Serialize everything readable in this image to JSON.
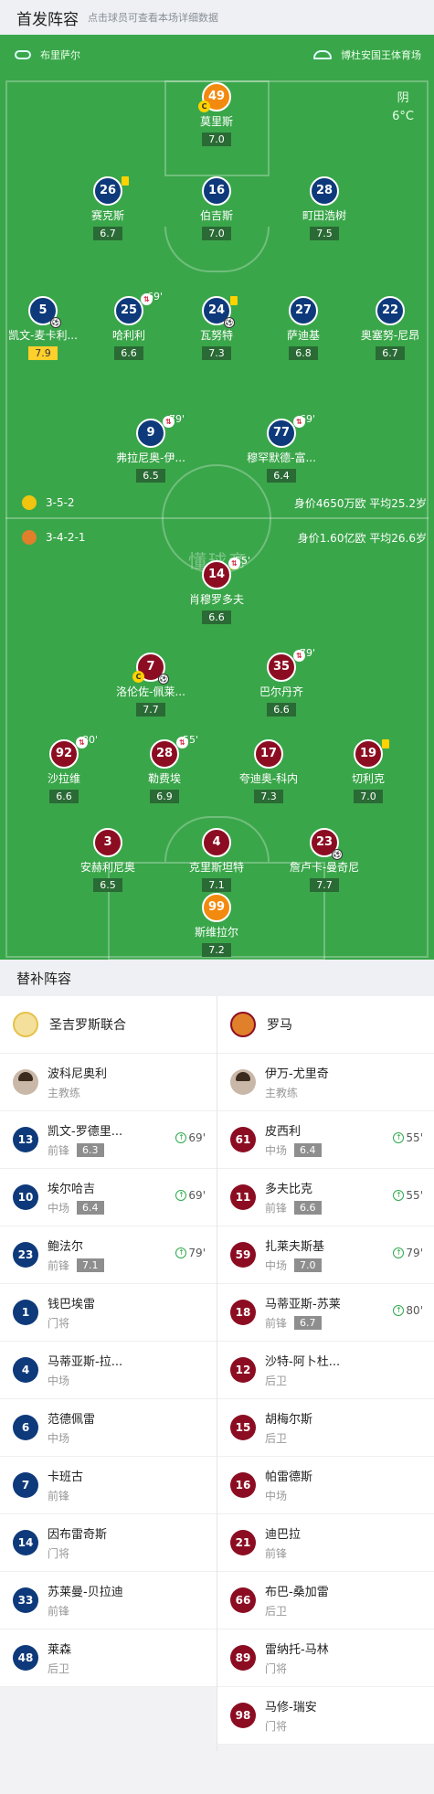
{
  "header": {
    "title": "首发阵容",
    "hint": "点击球员可查看本场详细数据"
  },
  "match": {
    "referee": "布里萨尔",
    "stadium": "博杜安国王体育场",
    "weather": "阴",
    "temp": "6°C",
    "watermark": "懂球帝"
  },
  "home": {
    "formation": "3-5-2",
    "value": "身价4650万欧 平均25.2岁",
    "logo_color": "#f1c40f"
  },
  "away": {
    "formation": "3-4-2-1",
    "value": "身价1.60亿欧 平均26.6岁",
    "logo_color": "#f39c12"
  },
  "home_players": [
    {
      "no": "49",
      "name": "莫里斯",
      "rating": "7.0",
      "kit": "o",
      "captain": true
    },
    {
      "no": "26",
      "name": "赛克斯",
      "rating": "6.7",
      "kit": "b",
      "yellow": true
    },
    {
      "no": "16",
      "name": "伯吉斯",
      "rating": "7.0",
      "kit": "b"
    },
    {
      "no": "28",
      "name": "町田浩树",
      "rating": "7.5",
      "kit": "b"
    },
    {
      "no": "5",
      "name": "凯文-麦卡利...",
      "rating": "7.9",
      "kit": "b",
      "ball": true,
      "star": true
    },
    {
      "no": "25",
      "name": "哈利利",
      "rating": "6.6",
      "kit": "b",
      "sub": "69'"
    },
    {
      "no": "24",
      "name": "瓦努特",
      "rating": "7.3",
      "kit": "b",
      "yellow": true,
      "ball": true
    },
    {
      "no": "27",
      "name": "萨迪基",
      "rating": "6.8",
      "kit": "b"
    },
    {
      "no": "22",
      "name": "奥塞努-尼昂",
      "rating": "6.7",
      "kit": "b"
    },
    {
      "no": "9",
      "name": "弗拉尼奥-伊...",
      "rating": "6.5",
      "kit": "b",
      "sub": "79'"
    },
    {
      "no": "77",
      "name": "穆罕默德-富...",
      "rating": "6.4",
      "kit": "b",
      "sub": "69'"
    }
  ],
  "away_players": [
    {
      "no": "14",
      "name": "肖穆罗多夫",
      "rating": "6.6",
      "kit": "r",
      "yellow": true,
      "sub": "55'"
    },
    {
      "no": "7",
      "name": "洛伦佐-佩莱...",
      "rating": "7.7",
      "kit": "r",
      "captain": true,
      "ball": true
    },
    {
      "no": "35",
      "name": "巴尔丹齐",
      "rating": "6.6",
      "kit": "r",
      "sub": "79'"
    },
    {
      "no": "92",
      "name": "沙拉维",
      "rating": "6.6",
      "kit": "r",
      "sub": "80'"
    },
    {
      "no": "28",
      "name": "勒费埃",
      "rating": "6.9",
      "kit": "r",
      "sub": "55'"
    },
    {
      "no": "17",
      "name": "夸迪奥-科内",
      "rating": "7.3",
      "kit": "r"
    },
    {
      "no": "19",
      "name": "切利克",
      "rating": "7.0",
      "kit": "r",
      "yellow": true
    },
    {
      "no": "3",
      "name": "安赫利尼奥",
      "rating": "6.5",
      "kit": "r"
    },
    {
      "no": "4",
      "name": "克里斯坦特",
      "rating": "7.1",
      "kit": "r"
    },
    {
      "no": "23",
      "name": "詹卢卡-曼奇尼",
      "rating": "7.7",
      "kit": "r",
      "ball": true
    },
    {
      "no": "99",
      "name": "斯维拉尔",
      "rating": "7.2",
      "kit": "o"
    }
  ],
  "bench_title": "替补阵容",
  "bench_home": {
    "team": "圣吉罗斯联合",
    "coach": "波科尼奥利",
    "coach_role": "主教练",
    "players": [
      {
        "no": "13",
        "name": "凯文-罗德里...",
        "pos": "前锋",
        "rating": "6.3",
        "time": "69'"
      },
      {
        "no": "10",
        "name": "埃尔哈吉",
        "pos": "中场",
        "rating": "6.4",
        "time": "69'"
      },
      {
        "no": "23",
        "name": "鲍法尔",
        "pos": "前锋",
        "rating": "7.1",
        "time": "79'"
      },
      {
        "no": "1",
        "name": "钱巴埃雷",
        "pos": "门将"
      },
      {
        "no": "4",
        "name": "马蒂亚斯-拉...",
        "pos": "中场"
      },
      {
        "no": "6",
        "name": "范德佩雷",
        "pos": "中场"
      },
      {
        "no": "7",
        "name": "卡班古",
        "pos": "前锋"
      },
      {
        "no": "14",
        "name": "因布雷奇斯",
        "pos": "门将"
      },
      {
        "no": "33",
        "name": "苏莱曼-贝拉迪",
        "pos": "前锋"
      },
      {
        "no": "48",
        "name": "莱森",
        "pos": "后卫"
      }
    ]
  },
  "bench_away": {
    "team": "罗马",
    "coach": "伊万-尤里奇",
    "coach_role": "主教练",
    "players": [
      {
        "no": "61",
        "name": "皮西利",
        "pos": "中场",
        "rating": "6.4",
        "time": "55'"
      },
      {
        "no": "11",
        "name": "多夫比克",
        "pos": "前锋",
        "rating": "6.6",
        "time": "55'"
      },
      {
        "no": "59",
        "name": "扎莱夫斯基",
        "pos": "中场",
        "rating": "7.0",
        "time": "79'"
      },
      {
        "no": "18",
        "name": "马蒂亚斯-苏莱",
        "pos": "前锋",
        "rating": "6.7",
        "time": "80'"
      },
      {
        "no": "12",
        "name": "沙特-阿卜杜...",
        "pos": "后卫"
      },
      {
        "no": "15",
        "name": "胡梅尔斯",
        "pos": "后卫"
      },
      {
        "no": "16",
        "name": "帕雷德斯",
        "pos": "中场"
      },
      {
        "no": "21",
        "name": "迪巴拉",
        "pos": "前锋"
      },
      {
        "no": "66",
        "name": "布巴-桑加雷",
        "pos": "后卫"
      },
      {
        "no": "89",
        "name": "雷纳托-马林",
        "pos": "门将"
      },
      {
        "no": "98",
        "name": "马修-瑞安",
        "pos": "门将"
      }
    ]
  }
}
